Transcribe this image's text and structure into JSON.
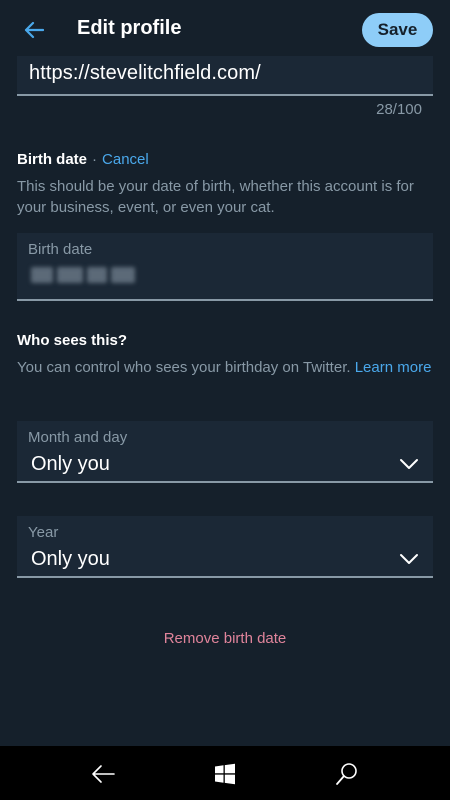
{
  "header": {
    "title": "Edit profile",
    "save_label": "Save"
  },
  "website": {
    "value": "https://stevelitchfield.com/",
    "counter": "28/100"
  },
  "birth_date": {
    "heading": "Birth date",
    "separator": "·",
    "cancel_label": "Cancel",
    "description": "This should be your date of birth, whether this account is for your business, event, or even your cat.",
    "field_label": "Birth date"
  },
  "visibility": {
    "heading": "Who sees this?",
    "description": "You can control who sees your birthday on Twitter.",
    "learn_more_label": "Learn more",
    "month_day": {
      "label": "Month and day",
      "value": "Only you"
    },
    "year": {
      "label": "Year",
      "value": "Only you"
    }
  },
  "remove_label": "Remove birth date",
  "nav": {
    "icons": [
      "back-arrow-icon",
      "windows-start-icon",
      "search-icon"
    ]
  },
  "colors": {
    "background": "#15202b",
    "accent": "#4aa8eb",
    "save_button": "#8ecdf8",
    "remove": "#e0849b",
    "secondary_text": "#8899a6"
  }
}
